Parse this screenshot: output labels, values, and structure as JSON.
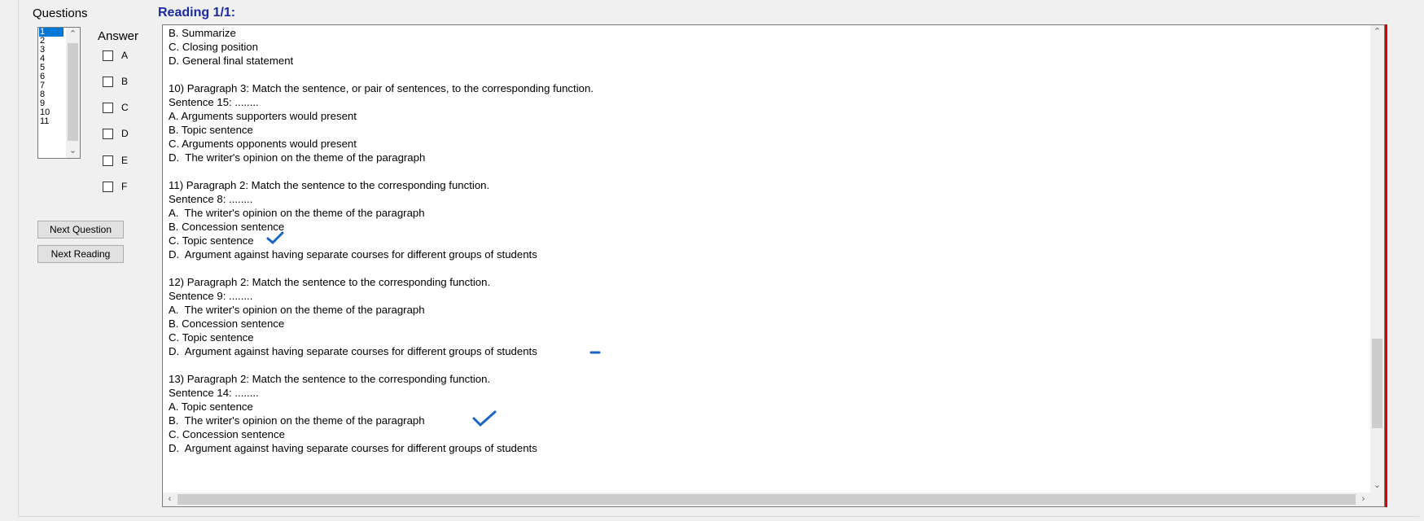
{
  "left_panel": {
    "questions_label": "Questions",
    "answer_label": "Answer",
    "question_numbers": [
      "1",
      "2",
      "3",
      "4",
      "5",
      "6",
      "7",
      "8",
      "9",
      "10",
      "11"
    ],
    "options": [
      "A",
      "B",
      "C",
      "D",
      "E",
      "F"
    ],
    "next_question_label": "Next Question",
    "next_reading_label": "Next Reading"
  },
  "reading": {
    "title": "Reading 1/1:",
    "lines": [
      "B. Summarize",
      "C. Closing position",
      "D. General final statement",
      "",
      "10) Paragraph 3: Match the sentence, or pair of sentences, to the corresponding function.",
      "Sentence 15: ........",
      "A. Arguments supporters would present",
      "B. Topic sentence",
      "C. Arguments opponents would present",
      "D.  The writer's opinion on the theme of the paragraph",
      "",
      "11) Paragraph 2: Match the sentence to the corresponding function.",
      "Sentence 8: ........",
      "A.  The writer's opinion on the theme of the paragraph",
      "B. Concession sentence",
      "C. Topic sentence",
      "D.  Argument against having separate courses for different groups of students",
      "",
      "12) Paragraph 2: Match the sentence to the corresponding function.",
      "Sentence 9: ........",
      "A.  The writer's opinion on the theme of the paragraph",
      "B. Concession sentence",
      "C. Topic sentence",
      "D.  Argument against having separate courses for different groups of students",
      "",
      "13) Paragraph 2: Match the sentence to the corresponding function.",
      "Sentence 14: ........",
      "A. Topic sentence",
      "B.  The writer's opinion on the theme of the paragraph",
      "C. Concession sentence",
      "D.  Argument against having separate courses for different groups of students"
    ]
  },
  "colors": {
    "title_blue": "#1a2b9c",
    "selection_blue": "#0078d7",
    "ink_blue": "#1a63c8",
    "edge_red": "#e00000"
  }
}
